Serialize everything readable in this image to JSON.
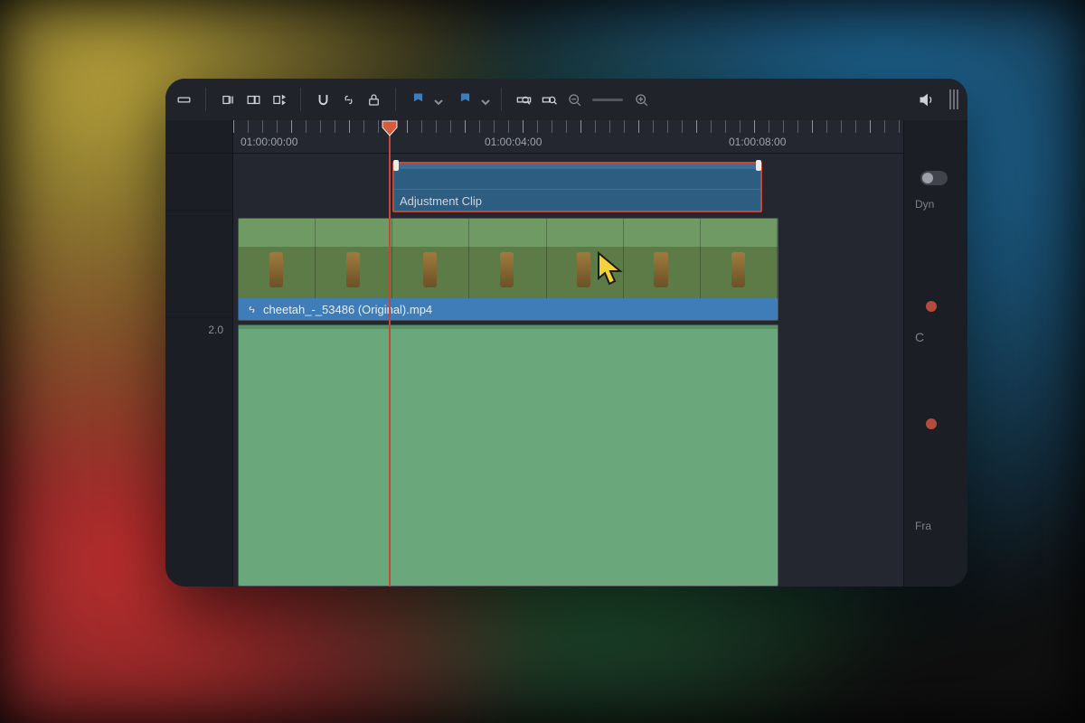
{
  "toolbar": {
    "icons": [
      "razor",
      "insert",
      "overwrite",
      "replace",
      "snap",
      "link",
      "lock",
      "flag-outline",
      "flag-solid",
      "zoom-full",
      "zoom-detail",
      "zoom-slider",
      "volume",
      "options"
    ]
  },
  "ruler": {
    "timecodes": [
      "01:00:00:00",
      "01:00:04:00",
      "01:00:08:00"
    ]
  },
  "tracks": {
    "adjustment": {
      "label": "Adjustment Clip"
    },
    "video": {
      "filename": "cheetah_-_53486 (Original).mp4"
    },
    "audio": {
      "channel_label": "2.0"
    }
  },
  "right_panel": {
    "label1": "Dyn",
    "label2": "C",
    "label3": "Fra"
  },
  "colors": {
    "accent_blue": "#3f7db8",
    "playhead": "#c24a33",
    "selection": "#c9462f",
    "audio": "#6aa77a"
  }
}
